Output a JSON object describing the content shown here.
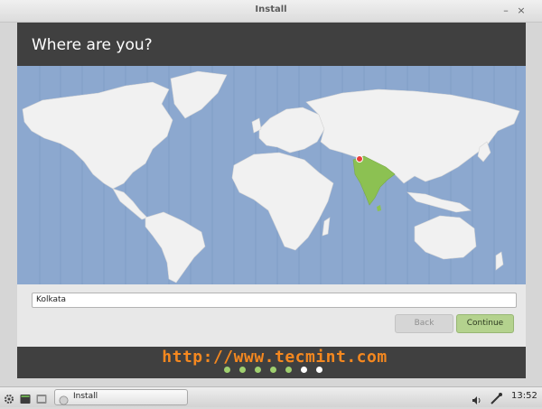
{
  "window": {
    "title": "Install"
  },
  "page": {
    "heading": "Where are you?",
    "city_value": "Kolkata",
    "back_label": "Back",
    "continue_label": "Continue"
  },
  "map": {
    "highlighted_country": "India",
    "highlight_color": "#8cc152",
    "marker_color": "#e8413c",
    "ocean_color": "#8ca8cf",
    "land_color": "#f1f1f1"
  },
  "watermark": "http://www.tecmint.com",
  "progress": {
    "total_steps": 7,
    "completed_steps": 5
  },
  "taskbar": {
    "task_label": "Install",
    "clock": "13:52"
  },
  "icons": {
    "menu": "gear-icon",
    "terminal": "terminal-icon",
    "files": "file-manager-icon",
    "task": "installer-icon",
    "volume": "volume-icon",
    "network": "network-icon"
  }
}
